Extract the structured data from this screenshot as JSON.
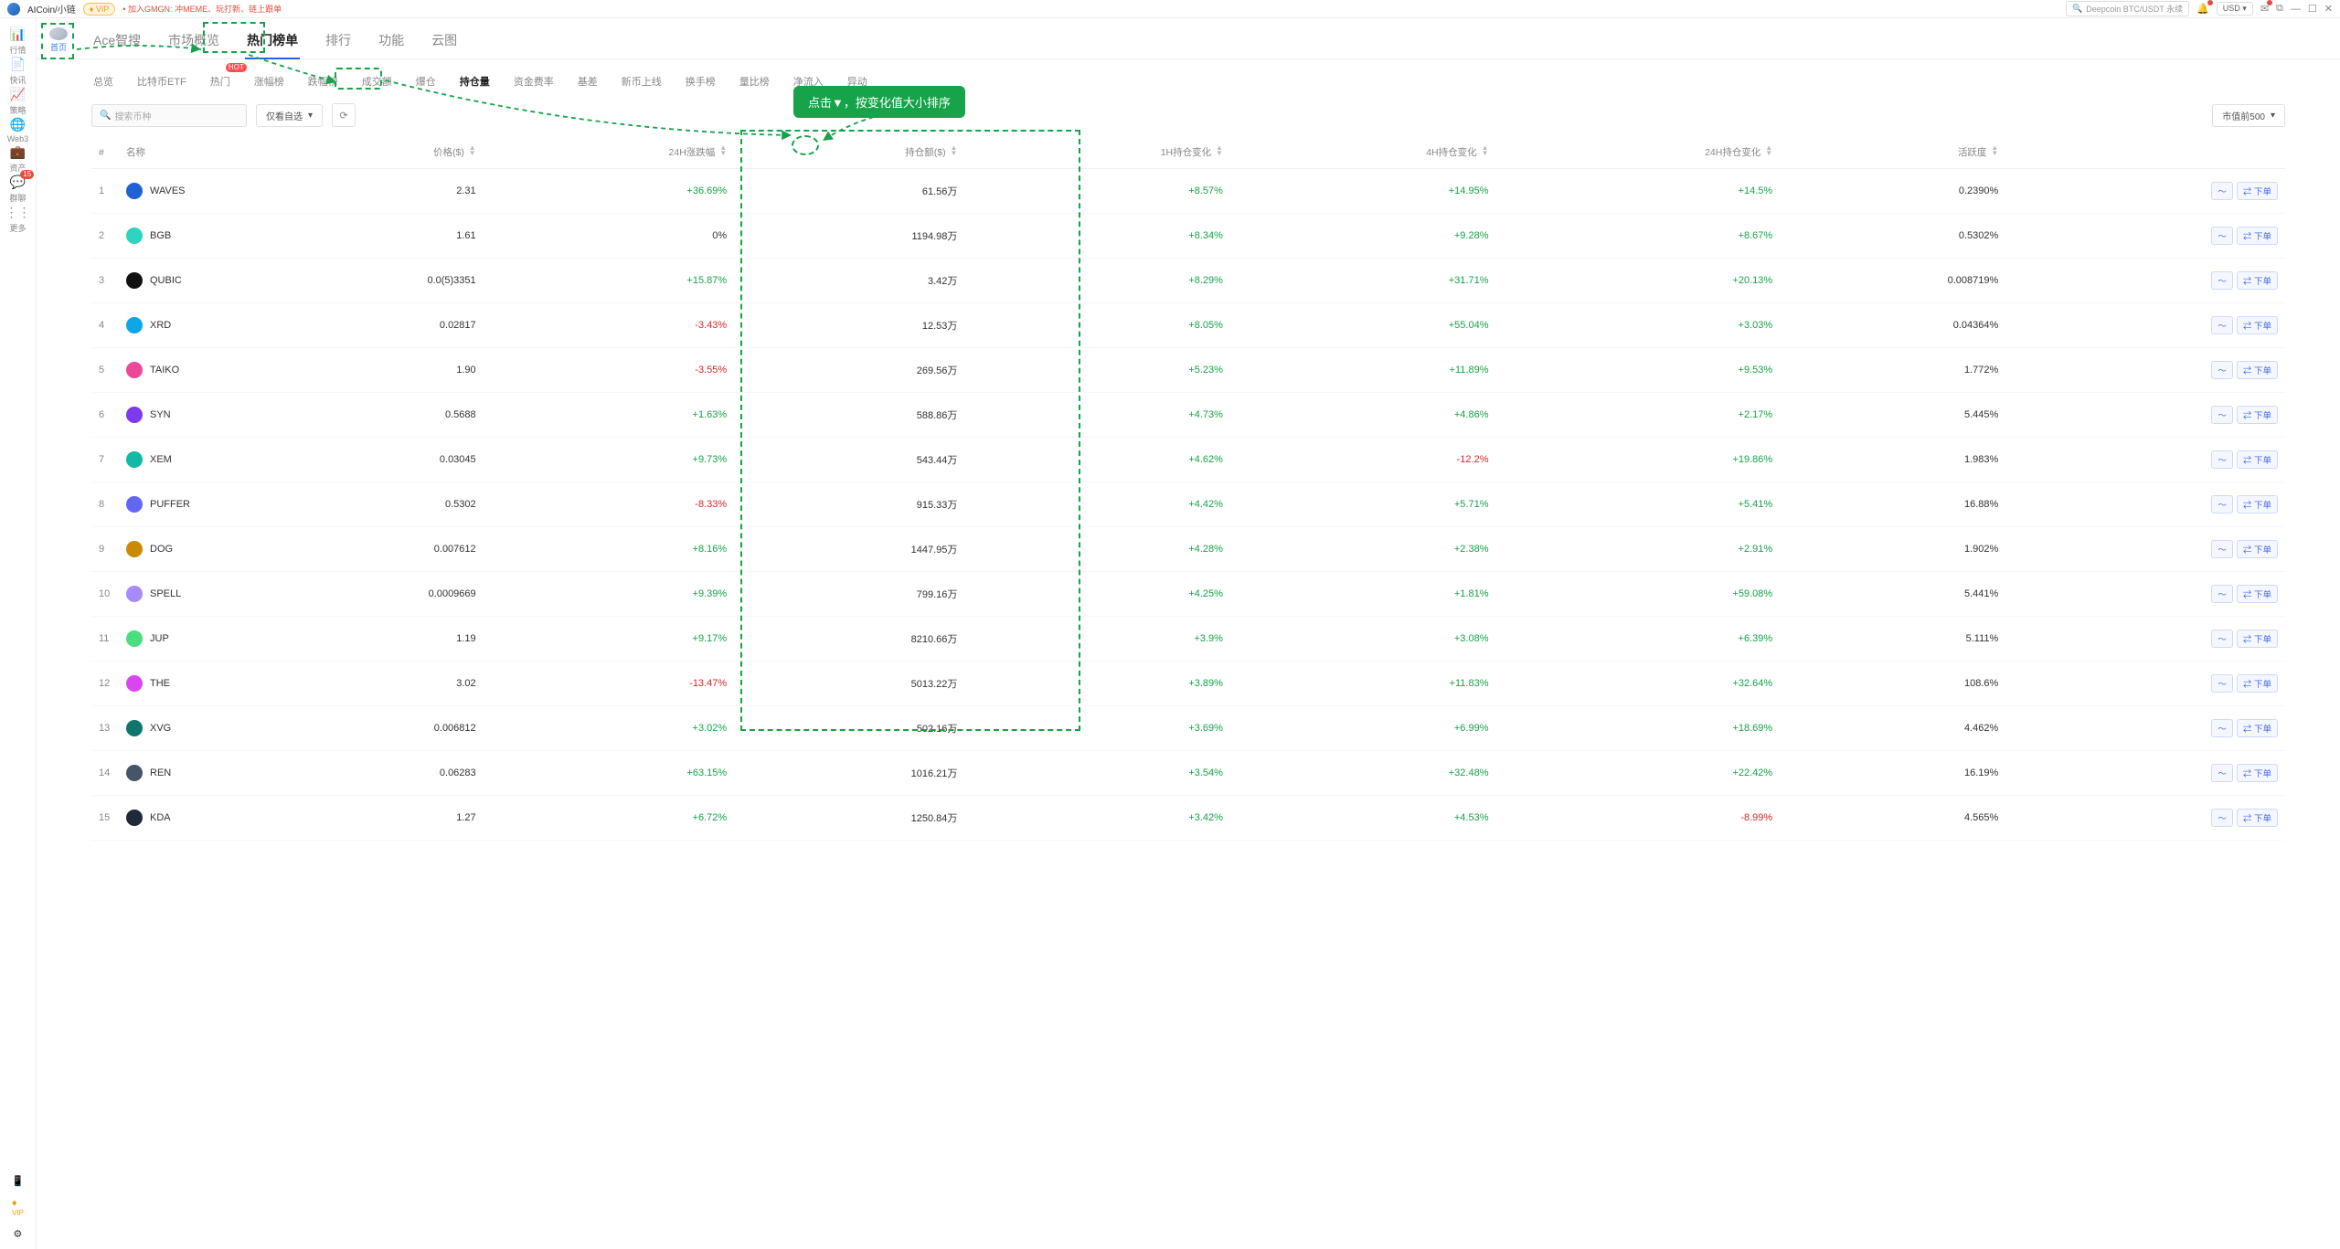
{
  "topbar": {
    "brand": "AICoin/小链",
    "vip": "VIP",
    "promo_prefix": "• 加入GMGN:",
    "promo": "冲MEME、玩打新、链上跟单",
    "search_placeholder": "Deepcoin BTC/USDT 永续",
    "currency": "USD"
  },
  "sidebar": {
    "home_label": "首页",
    "items": [
      {
        "icon": "📊",
        "label": "行情"
      },
      {
        "icon": "📄",
        "label": "快讯"
      },
      {
        "icon": "📈",
        "label": "策略"
      },
      {
        "icon": "🌐",
        "label": "Web3"
      },
      {
        "icon": "💼",
        "label": "资产"
      },
      {
        "icon": "💬",
        "label": "群聊",
        "badge": "15"
      },
      {
        "icon": "⋮⋮",
        "label": "更多"
      }
    ]
  },
  "navtabs": [
    "Ace智搜",
    "市场概览",
    "热门榜单",
    "排行",
    "功能",
    "云图"
  ],
  "navtabs_active": 2,
  "subtabs": [
    "总览",
    "比特币ETF",
    "热门",
    "涨幅榜",
    "跌幅榜",
    "成交额",
    "爆仓",
    "持仓量",
    "资金费率",
    "基差",
    "新币上线",
    "换手榜",
    "量比榜",
    "净流入",
    "异动"
  ],
  "subtabs_hot_index": 2,
  "subtabs_active": 7,
  "controls": {
    "search_placeholder": "搜索币种",
    "filter": "仅看自选",
    "marketcap": "市值前500"
  },
  "columns": [
    "#",
    "名称",
    "价格($)",
    "24H涨跌幅",
    "持仓额($)",
    "1H持仓变化",
    "4H持仓变化",
    "24H持仓变化",
    "活跃度",
    ""
  ],
  "callout_text": "点击▼，按变化值大小排序",
  "actions": {
    "chart_label": "",
    "order_label": "下单"
  },
  "rows": [
    {
      "n": 1,
      "sym": "WAVES",
      "color": "#1e62d6",
      "price": "2.31",
      "chg": "+36.69%",
      "chg_sign": 1,
      "oi": "61.56万",
      "h1": "+8.57%",
      "h1s": 1,
      "h4": "+14.95%",
      "h4s": 1,
      "h24": "+14.5%",
      "h24s": 1,
      "act": "0.2390%"
    },
    {
      "n": 2,
      "sym": "BGB",
      "color": "#2dd4bf",
      "price": "1.61",
      "chg": "0%",
      "chg_sign": 0,
      "oi": "1194.98万",
      "h1": "+8.34%",
      "h1s": 1,
      "h4": "+9.28%",
      "h4s": 1,
      "h24": "+8.67%",
      "h24s": 1,
      "act": "0.5302%"
    },
    {
      "n": 3,
      "sym": "QUBIC",
      "color": "#111",
      "price": "0.0(5)3351",
      "chg": "+15.87%",
      "chg_sign": 1,
      "oi": "3.42万",
      "h1": "+8.29%",
      "h1s": 1,
      "h4": "+31.71%",
      "h4s": 1,
      "h24": "+20.13%",
      "h24s": 1,
      "act": "0.008719%"
    },
    {
      "n": 4,
      "sym": "XRD",
      "color": "#0ea5e9",
      "price": "0.02817",
      "chg": "-3.43%",
      "chg_sign": -1,
      "oi": "12.53万",
      "h1": "+8.05%",
      "h1s": 1,
      "h4": "+55.04%",
      "h4s": 1,
      "h24": "+3.03%",
      "h24s": 1,
      "act": "0.04364%"
    },
    {
      "n": 5,
      "sym": "TAIKO",
      "color": "#ec4899",
      "price": "1.90",
      "chg": "-3.55%",
      "chg_sign": -1,
      "oi": "269.56万",
      "h1": "+5.23%",
      "h1s": 1,
      "h4": "+11.89%",
      "h4s": 1,
      "h24": "+9.53%",
      "h24s": 1,
      "act": "1.772%"
    },
    {
      "n": 6,
      "sym": "SYN",
      "color": "#7c3aed",
      "price": "0.5688",
      "chg": "+1.63%",
      "chg_sign": 1,
      "oi": "588.86万",
      "h1": "+4.73%",
      "h1s": 1,
      "h4": "+4.86%",
      "h4s": 1,
      "h24": "+2.17%",
      "h24s": 1,
      "act": "5.445%"
    },
    {
      "n": 7,
      "sym": "XEM",
      "color": "#14b8a6",
      "price": "0.03045",
      "chg": "+9.73%",
      "chg_sign": 1,
      "oi": "543.44万",
      "h1": "+4.62%",
      "h1s": 1,
      "h4": "-12.2%",
      "h4s": -1,
      "h24": "+19.86%",
      "h24s": 1,
      "act": "1.983%"
    },
    {
      "n": 8,
      "sym": "PUFFER",
      "color": "#6366f1",
      "price": "0.5302",
      "chg": "-8.33%",
      "chg_sign": -1,
      "oi": "915.33万",
      "h1": "+4.42%",
      "h1s": 1,
      "h4": "+5.71%",
      "h4s": 1,
      "h24": "+5.41%",
      "h24s": 1,
      "act": "16.88%"
    },
    {
      "n": 9,
      "sym": "DOG",
      "color": "#ca8a04",
      "price": "0.007612",
      "chg": "+8.16%",
      "chg_sign": 1,
      "oi": "1447.95万",
      "h1": "+4.28%",
      "h1s": 1,
      "h4": "+2.38%",
      "h4s": 1,
      "h24": "+2.91%",
      "h24s": 1,
      "act": "1.902%"
    },
    {
      "n": 10,
      "sym": "SPELL",
      "color": "#a78bfa",
      "price": "0.0009669",
      "chg": "+9.39%",
      "chg_sign": 1,
      "oi": "799.16万",
      "h1": "+4.25%",
      "h1s": 1,
      "h4": "+1.81%",
      "h4s": 1,
      "h24": "+59.08%",
      "h24s": 1,
      "act": "5.441%"
    },
    {
      "n": 11,
      "sym": "JUP",
      "color": "#4ade80",
      "price": "1.19",
      "chg": "+9.17%",
      "chg_sign": 1,
      "oi": "8210.66万",
      "h1": "+3.9%",
      "h1s": 1,
      "h4": "+3.08%",
      "h4s": 1,
      "h24": "+6.39%",
      "h24s": 1,
      "act": "5.111%"
    },
    {
      "n": 12,
      "sym": "THE",
      "color": "#d946ef",
      "price": "3.02",
      "chg": "-13.47%",
      "chg_sign": -1,
      "oi": "5013.22万",
      "h1": "+3.89%",
      "h1s": 1,
      "h4": "+11.83%",
      "h4s": 1,
      "h24": "+32.64%",
      "h24s": 1,
      "act": "108.6%"
    },
    {
      "n": 13,
      "sym": "XVG",
      "color": "#0f766e",
      "price": "0.006812",
      "chg": "+3.02%",
      "chg_sign": 1,
      "oi": "502.16万",
      "h1": "+3.69%",
      "h1s": 1,
      "h4": "+6.99%",
      "h4s": 1,
      "h24": "+18.69%",
      "h24s": 1,
      "act": "4.462%"
    },
    {
      "n": 14,
      "sym": "REN",
      "color": "#475569",
      "price": "0.06283",
      "chg": "+63.15%",
      "chg_sign": 1,
      "oi": "1016.21万",
      "h1": "+3.54%",
      "h1s": 1,
      "h4": "+32.48%",
      "h4s": 1,
      "h24": "+22.42%",
      "h24s": 1,
      "act": "16.19%"
    },
    {
      "n": 15,
      "sym": "KDA",
      "color": "#1e293b",
      "price": "1.27",
      "chg": "+6.72%",
      "chg_sign": 1,
      "oi": "1250.84万",
      "h1": "+3.42%",
      "h1s": 1,
      "h4": "+4.53%",
      "h4s": 1,
      "h24": "-8.99%",
      "h24s": -1,
      "act": "4.565%"
    }
  ]
}
